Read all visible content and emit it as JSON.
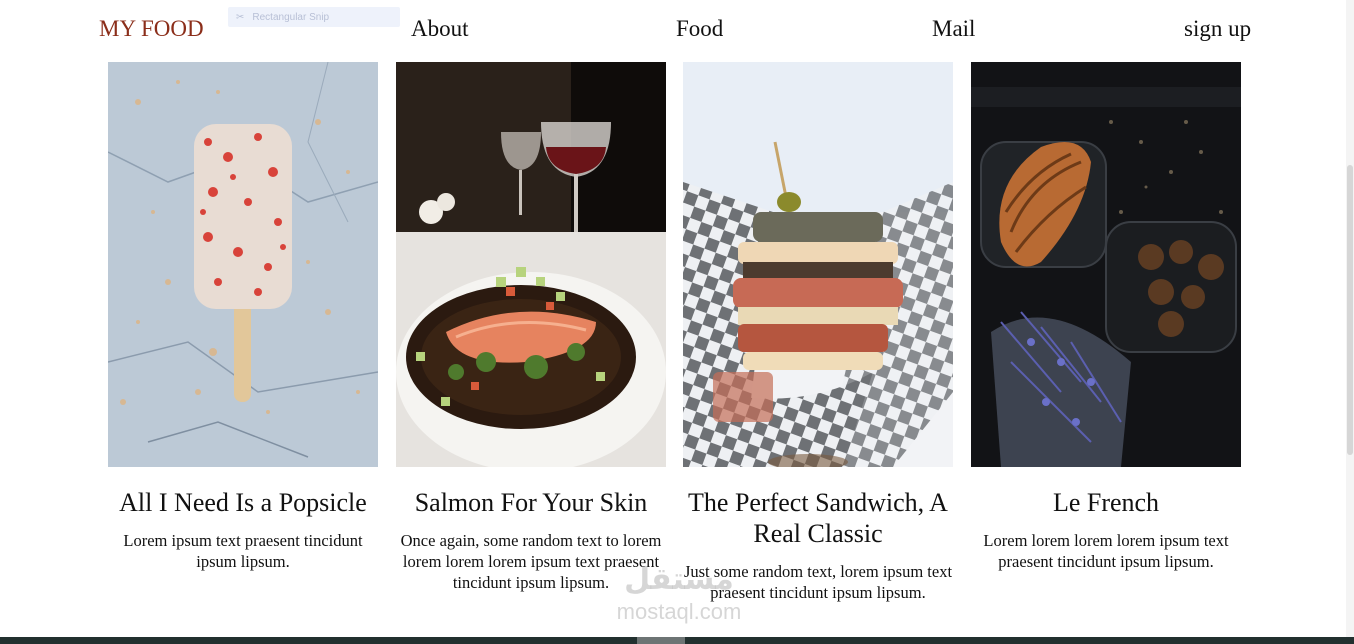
{
  "nav": {
    "brand": "MY FOOD",
    "links": [
      "About",
      "Food",
      "Mail",
      "sign up"
    ]
  },
  "tooltip": {
    "text": "Rectangular Snip"
  },
  "cards": [
    {
      "title": "All I Need Is a Popsicle",
      "text": "Lorem ipsum text praesent tincidunt ipsum lipsum.",
      "image": "popsicle-photo"
    },
    {
      "title": "Salmon For Your Skin",
      "text": "Once again, some random text to lorem lorem lorem lorem ipsum text praesent tincidunt ipsum lipsum.",
      "image": "salmon-plate-photo"
    },
    {
      "title": "The Perfect Sandwich, A Real Classic",
      "text": "Just some random text, lorem ipsum text praesent tincidunt ipsum lipsum.",
      "image": "sandwich-photo"
    },
    {
      "title": "Le French",
      "text": "Lorem lorem lorem lorem ipsum text praesent tincidunt ipsum lipsum.",
      "image": "croissant-photo"
    }
  ],
  "watermark": {
    "arabic": "مستقل",
    "latin": "mostaql.com"
  },
  "colors": {
    "brand": "#8b2e1a",
    "footer": "#22302f"
  }
}
